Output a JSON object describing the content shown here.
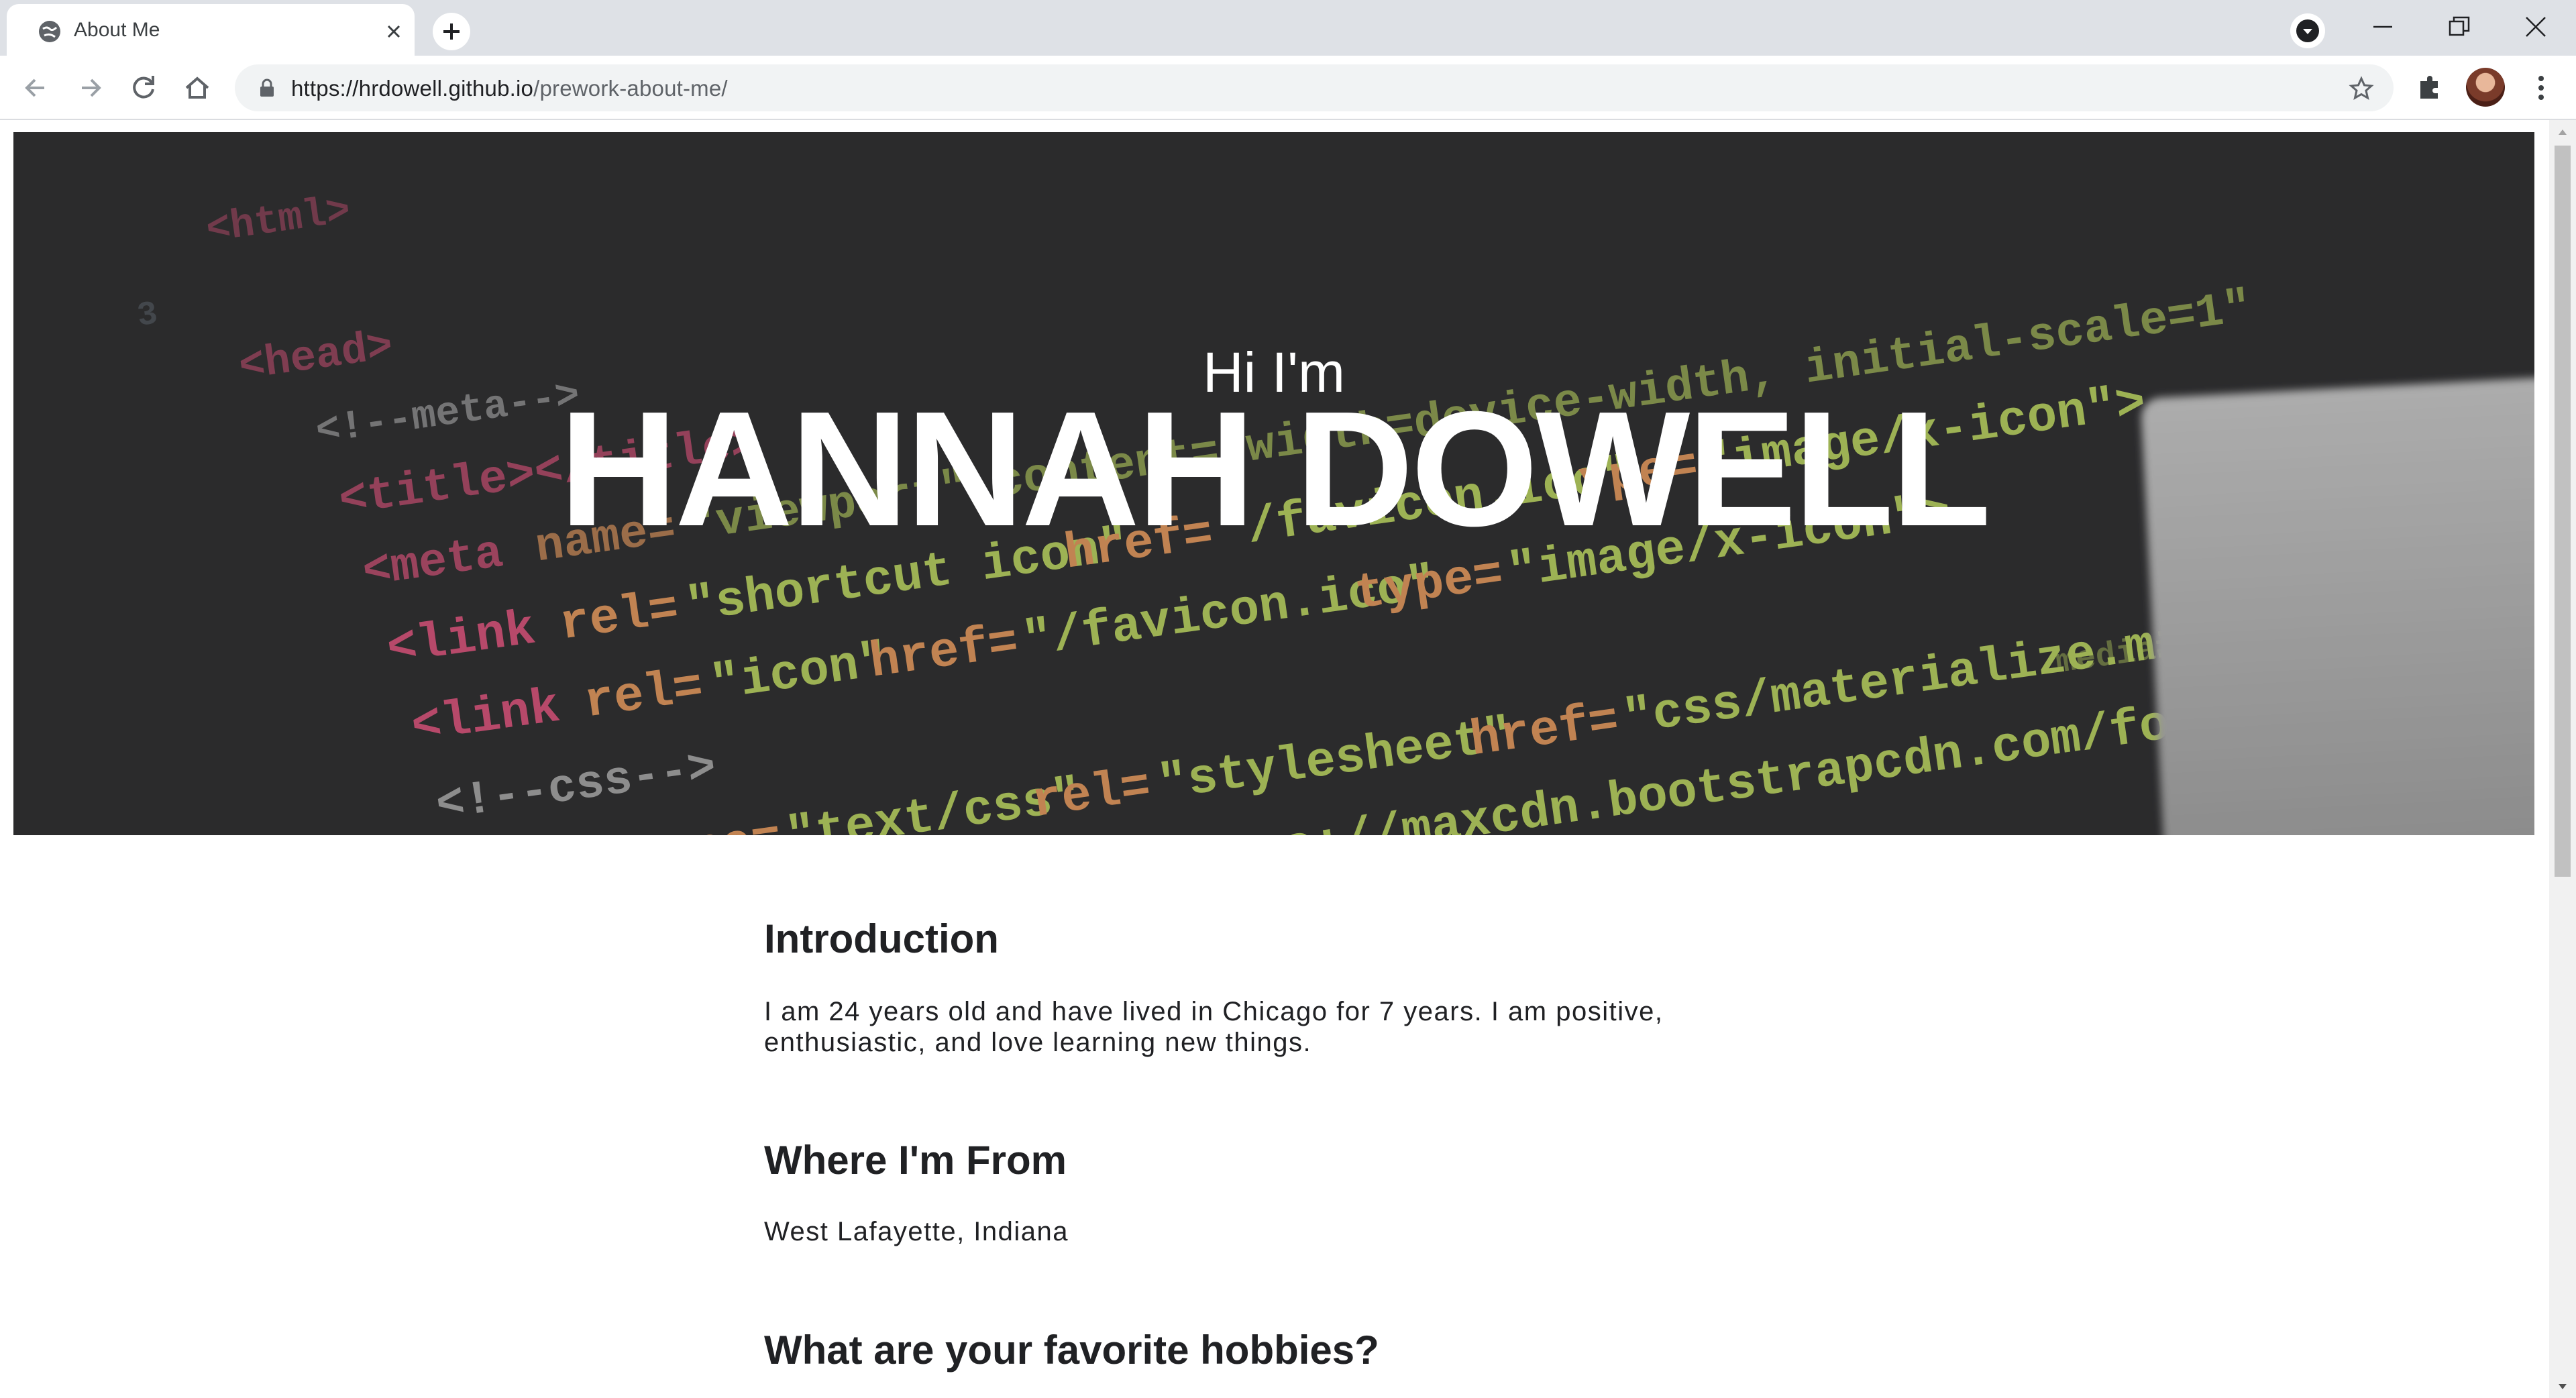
{
  "browser": {
    "tab_title": "About Me",
    "url_host": "https://hrdowell.github.io",
    "url_path": "/prework-about-me/"
  },
  "hero": {
    "greeting": "Hi I'm",
    "name": "HANNAH DOWELL",
    "background_image": "code-editor-screenshot"
  },
  "sections": [
    {
      "heading": "Introduction",
      "text": "I am 24 years old and have lived in Chicago for 7 years. I am positive, enthusiastic, and love learning new things."
    },
    {
      "heading": "Where I'm From",
      "text": "West Lafayette, Indiana"
    },
    {
      "heading": "What are your favorite hobbies?"
    }
  ],
  "colors": {
    "heading_text": "#202124",
    "hero_text": "#ffffff",
    "hero_bg": "#2c2c2e",
    "chrome_tabstrip": "#dee1e6"
  }
}
